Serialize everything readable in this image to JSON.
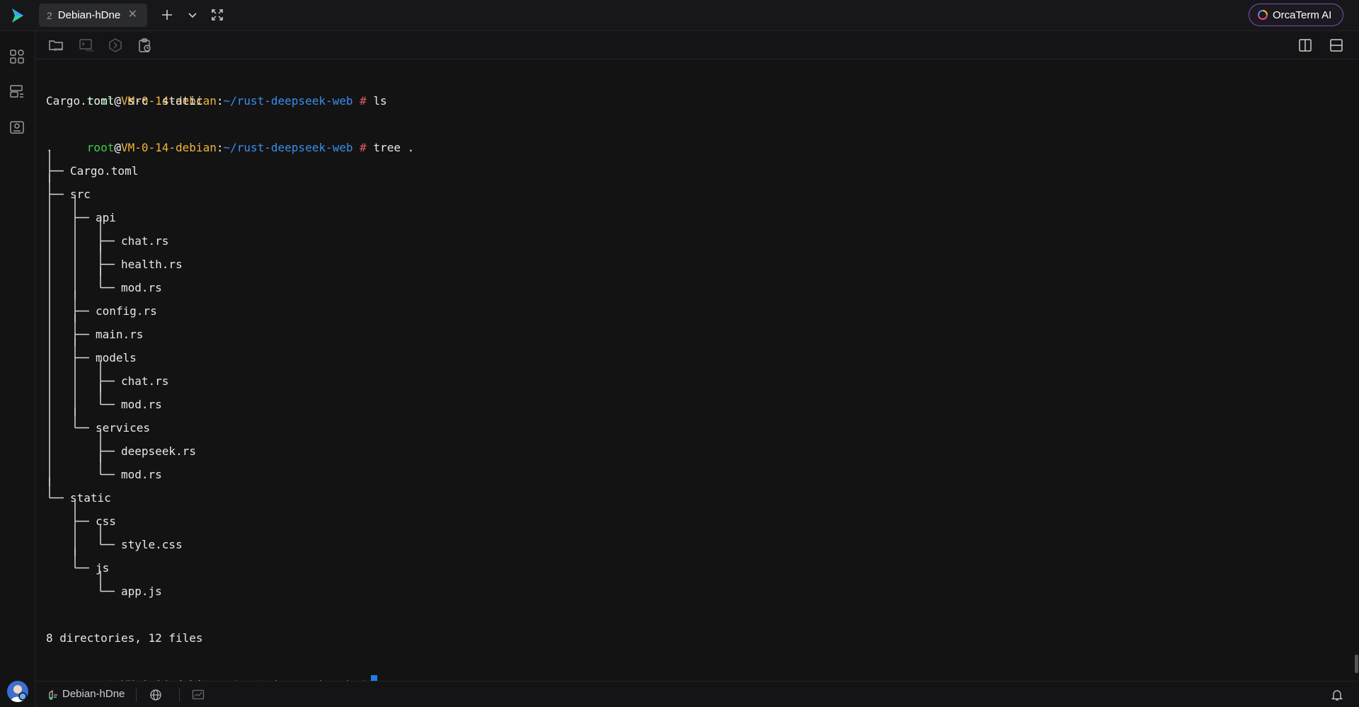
{
  "app": {
    "tab_number": "2",
    "tab_title": "Debian-hDne",
    "ai_button_label": "OrcaTerm AI",
    "accent": "#1e7fe8"
  },
  "toolbar": {
    "icons": [
      "sftp-icon",
      "tmux-icon",
      "snippet-icon",
      "clipboard-icon"
    ],
    "sftp_label": "SFTP",
    "tmux_label": "Tmux"
  },
  "terminal": {
    "prompt": {
      "user": "root",
      "at": "@",
      "host": "VM-0-14-debian",
      "colon": ":",
      "path": "~/rust-deepseek-web",
      "hash": "#"
    },
    "cmd1": "ls",
    "ls_output": "Cargo.toml  src  static",
    "cmd2": "tree .",
    "tree_root": ".",
    "tree": [
      {
        "depth": 0,
        "last": false,
        "name": "Cargo.toml"
      },
      {
        "depth": 0,
        "last": false,
        "name": "src"
      },
      {
        "depth": 1,
        "last": false,
        "name": "api"
      },
      {
        "depth": 2,
        "last": false,
        "name": "chat.rs"
      },
      {
        "depth": 2,
        "last": false,
        "name": "health.rs"
      },
      {
        "depth": 2,
        "last": true,
        "name": "mod.rs"
      },
      {
        "depth": 1,
        "last": false,
        "name": "config.rs"
      },
      {
        "depth": 1,
        "last": false,
        "name": "main.rs"
      },
      {
        "depth": 1,
        "last": false,
        "name": "models"
      },
      {
        "depth": 2,
        "last": false,
        "name": "chat.rs"
      },
      {
        "depth": 2,
        "last": true,
        "name": "mod.rs"
      },
      {
        "depth": 1,
        "last": true,
        "name": "services"
      },
      {
        "depth": 2,
        "last": false,
        "name": "deepseek.rs"
      },
      {
        "depth": 2,
        "last": true,
        "name": "mod.rs"
      },
      {
        "depth": 0,
        "last": true,
        "name": "static"
      },
      {
        "depth": 1,
        "last": false,
        "name": "css"
      },
      {
        "depth": 2,
        "last": true,
        "name": "style.css"
      },
      {
        "depth": 1,
        "last": true,
        "name": "js"
      },
      {
        "depth": 2,
        "last": true,
        "name": "app.js"
      }
    ],
    "summary": "8 directories, 12 files"
  },
  "statusbar": {
    "host_label": "Debian-hDne"
  }
}
